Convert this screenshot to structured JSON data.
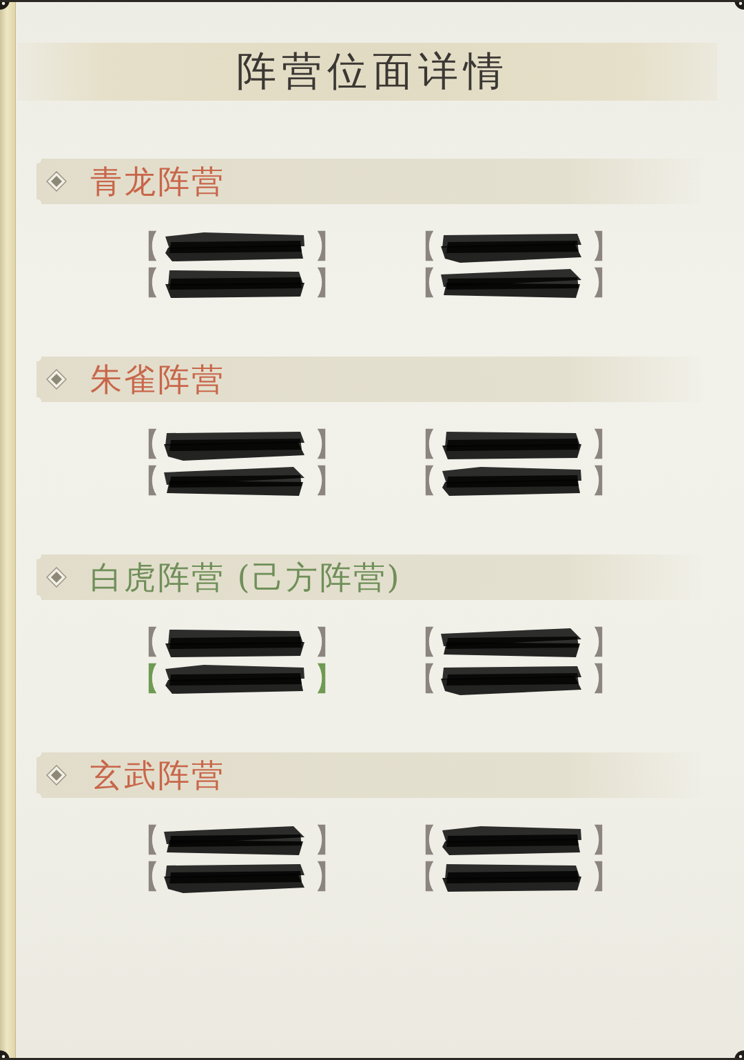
{
  "title": "阵营位面详情",
  "factions": [
    {
      "name": "青龙阵营",
      "own": false,
      "entries": [
        {
          "open": "【",
          "close": "】",
          "own": false,
          "redacted": true
        },
        {
          "open": "【",
          "close": "】",
          "own": false,
          "redacted": true
        },
        {
          "open": "【",
          "close": "】",
          "own": false,
          "redacted": true
        },
        {
          "open": "【",
          "close": "】",
          "own": false,
          "redacted": true
        }
      ]
    },
    {
      "name": "朱雀阵营",
      "own": false,
      "entries": [
        {
          "open": "【",
          "close": "】",
          "own": false,
          "redacted": true
        },
        {
          "open": "【",
          "close": "】",
          "own": false,
          "redacted": true
        },
        {
          "open": "【",
          "close": "】",
          "own": false,
          "redacted": true
        },
        {
          "open": "【",
          "close": "】",
          "own": false,
          "redacted": true
        }
      ]
    },
    {
      "name": "白虎阵营 (己方阵营)",
      "own": true,
      "entries": [
        {
          "open": "【",
          "close": "】",
          "own": false,
          "redacted": true
        },
        {
          "open": "【",
          "close": "】",
          "own": false,
          "redacted": true
        },
        {
          "open": "【",
          "close": "】",
          "own": true,
          "redacted": true
        },
        {
          "open": "【",
          "close": "】",
          "own": false,
          "redacted": true
        }
      ]
    },
    {
      "name": "玄武阵营",
      "own": false,
      "entries": [
        {
          "open": "【",
          "close": "】",
          "own": false,
          "redacted": true
        },
        {
          "open": "【",
          "close": "】",
          "own": false,
          "redacted": true
        },
        {
          "open": "【",
          "close": "】",
          "own": false,
          "redacted": true
        },
        {
          "open": "【",
          "close": "】",
          "own": false,
          "redacted": true
        }
      ]
    }
  ]
}
